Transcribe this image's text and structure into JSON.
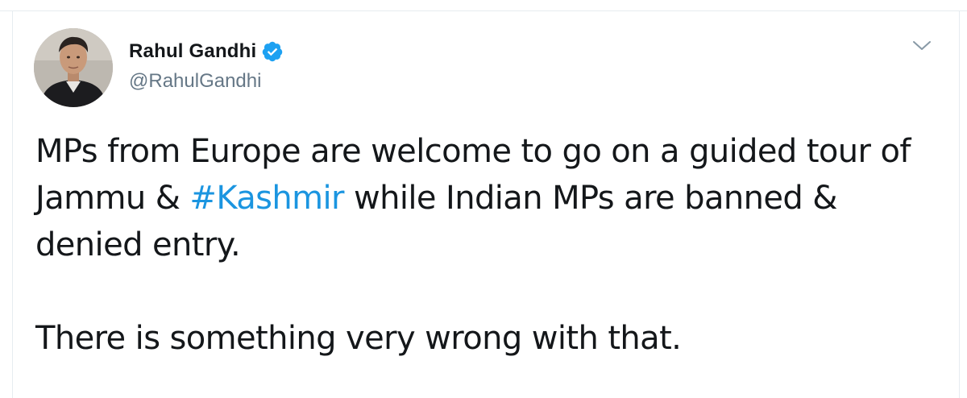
{
  "user": {
    "display_name": "Rahul Gandhi",
    "handle": "@RahulGandhi",
    "verified": true,
    "avatar": "profile-photo"
  },
  "tweet": {
    "line1_before": "MPs from Europe are welcome to go on a guided tour of Jammu & ",
    "hashtag": "#Kashmir",
    "line1_after": " while Indian MPs are banned & denied entry.",
    "paragraph2": "There is something very wrong with that."
  },
  "icons": {
    "verified": "verified-badge-icon",
    "menu": "chevron-down-icon"
  },
  "colors": {
    "text": "#14171a",
    "secondary": "#657786",
    "link": "#1b95e0",
    "verified": "#1da1f2",
    "border": "#e6ecf0"
  }
}
